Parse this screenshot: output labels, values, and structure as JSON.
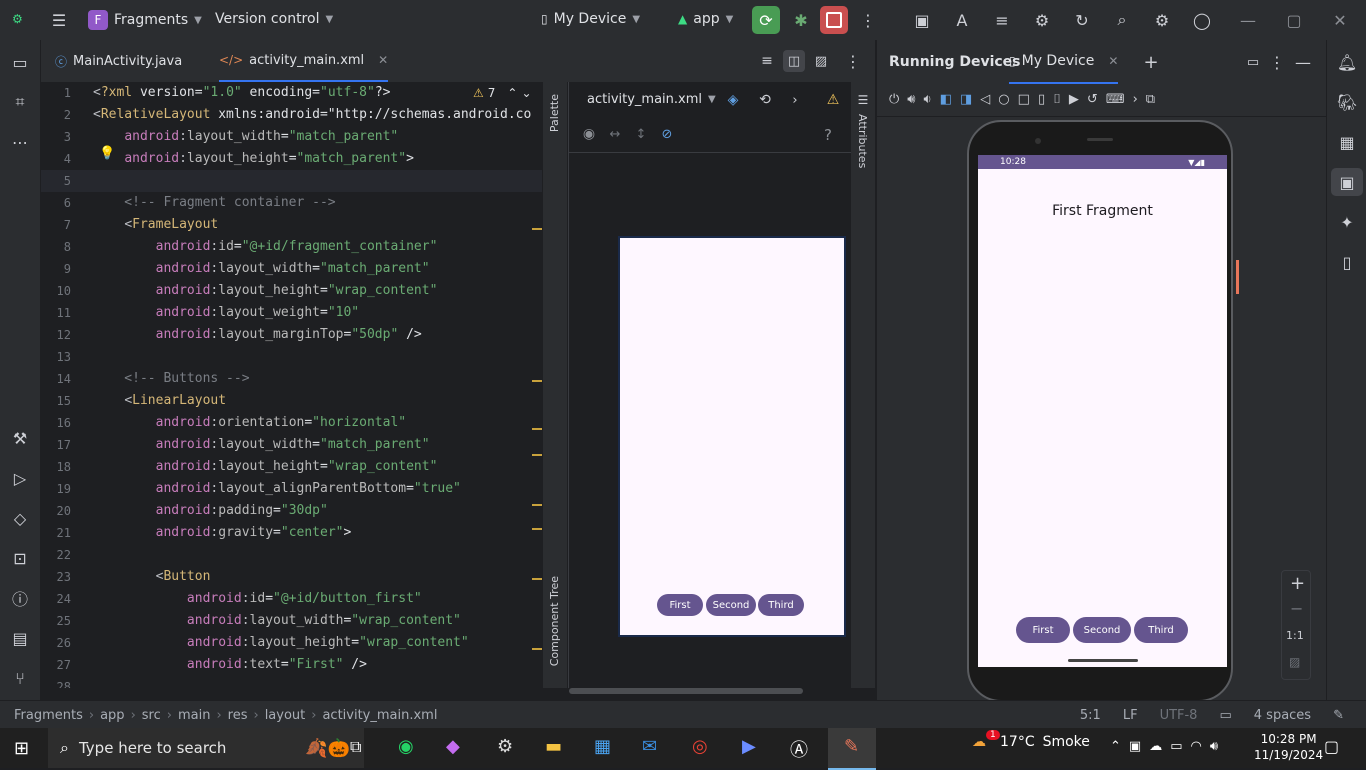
{
  "titlebar": {
    "project_letter": "F",
    "project_name": "Fragments",
    "vcs_label": "Version control",
    "device_label": "My Device",
    "run_config": "app"
  },
  "tabs": [
    {
      "label": "MainActivity.java",
      "icon": "java-class-icon"
    },
    {
      "label": "activity_main.xml",
      "icon": "xml-icon",
      "active": true
    }
  ],
  "editor": {
    "warning_count": "7",
    "lines": [
      {
        "n": "1",
        "t": "<?xml version=\"1.0\" encoding=\"utf-8\"?>"
      },
      {
        "n": "2",
        "t": "<RelativeLayout xmlns:android=\"http://schemas.android.co"
      },
      {
        "n": "3",
        "t": "    android:layout_width=\"match_parent\""
      },
      {
        "n": "4",
        "t": "    android:layout_height=\"match_parent\">"
      },
      {
        "n": "5",
        "t": ""
      },
      {
        "n": "6",
        "t": "    <!-- Fragment container -->"
      },
      {
        "n": "7",
        "t": "    <FrameLayout"
      },
      {
        "n": "8",
        "t": "        android:id=\"@+id/fragment_container\""
      },
      {
        "n": "9",
        "t": "        android:layout_width=\"match_parent\""
      },
      {
        "n": "10",
        "t": "        android:layout_height=\"wrap_content\""
      },
      {
        "n": "11",
        "t": "        android:layout_weight=\"10\""
      },
      {
        "n": "12",
        "t": "        android:layout_marginTop=\"50dp\" />"
      },
      {
        "n": "13",
        "t": ""
      },
      {
        "n": "14",
        "t": "    <!-- Buttons -->"
      },
      {
        "n": "15",
        "t": "    <LinearLayout"
      },
      {
        "n": "16",
        "t": "        android:orientation=\"horizontal\""
      },
      {
        "n": "17",
        "t": "        android:layout_width=\"match_parent\""
      },
      {
        "n": "18",
        "t": "        android:layout_height=\"wrap_content\""
      },
      {
        "n": "19",
        "t": "        android:layout_alignParentBottom=\"true\""
      },
      {
        "n": "20",
        "t": "        android:padding=\"30dp\""
      },
      {
        "n": "21",
        "t": "        android:gravity=\"center\">"
      },
      {
        "n": "22",
        "t": ""
      },
      {
        "n": "23",
        "t": "        <Button"
      },
      {
        "n": "24",
        "t": "            android:id=\"@+id/button_first\""
      },
      {
        "n": "25",
        "t": "            android:layout_width=\"wrap_content\""
      },
      {
        "n": "26",
        "t": "            android:layout_height=\"wrap_content\""
      },
      {
        "n": "27",
        "t": "            android:text=\"First\" />"
      },
      {
        "n": "28",
        "t": ""
      }
    ]
  },
  "design": {
    "file_selector": "activity_main.xml",
    "palette_label": "Palette",
    "component_tree_label": "Component Tree",
    "attributes_label": "Attributes",
    "help": "?",
    "buttons": [
      "First",
      "Second",
      "Third"
    ]
  },
  "devices": {
    "panel_title": "Running Devices",
    "tab_label": "My Device",
    "phone_time": "10:28",
    "fragment_text": "First Fragment",
    "buttons": [
      "First",
      "Second",
      "Third"
    ],
    "zoom_label": "1:1"
  },
  "statusbar": {
    "breadcrumb": [
      "Fragments",
      "app",
      "src",
      "main",
      "res",
      "layout",
      "activity_main.xml"
    ],
    "position": "5:1",
    "line_sep": "LF",
    "encoding": "UTF-8",
    "indent": "4 spaces"
  },
  "taskbar": {
    "search_placeholder": "Type here to search",
    "weather_temp": "17°C",
    "weather_desc": "Smoke",
    "time": "10:28 PM",
    "date": "11/19/2024",
    "notification_badge": "1"
  },
  "colors": {
    "accent_purple": "#65558f",
    "run_green": "#499c54",
    "stop_red": "#c94f4f"
  }
}
